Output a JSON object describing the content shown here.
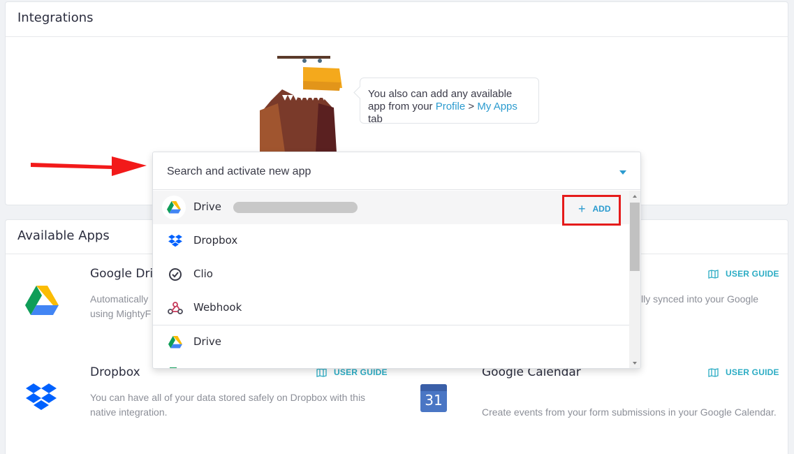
{
  "integrations": {
    "title": "Integrations",
    "bubble": {
      "text_before": "You also can add any available app from your ",
      "profile_link": "Profile",
      "separator": " > ",
      "my_apps_link": "My Apps",
      "text_after": " tab"
    }
  },
  "dropdown": {
    "placeholder": "Search and activate new app",
    "options": [
      {
        "label": "Drive",
        "icon": "google-drive-icon"
      },
      {
        "label": "Dropbox",
        "icon": "dropbox-icon"
      },
      {
        "label": "Clio",
        "icon": "clio-icon"
      },
      {
        "label": "Webhook",
        "icon": "webhook-icon"
      },
      {
        "label": "Drive",
        "icon": "google-drive-icon"
      }
    ],
    "add_label": "ADD"
  },
  "available_apps": {
    "title": "Available Apps",
    "guide_label": "USER GUIDE",
    "apps": [
      {
        "name": "Google Drive",
        "desc_line1": "Automatically",
        "desc_line2": "using MightyF",
        "icon": "google-drive-icon"
      },
      {
        "name": "",
        "desc_line1": "lly synced into your Google",
        "desc_line2": "",
        "icon": ""
      },
      {
        "name": "Dropbox",
        "desc_line1": "You can have all of your data stored safely on Dropbox with this",
        "desc_line2": "native integration.",
        "icon": "dropbox-icon"
      },
      {
        "name": "Google Calendar",
        "desc_line1": "Create events from your form submissions in your Google Calendar.",
        "desc_line2": "",
        "icon": "google-calendar-icon",
        "calendar_day": "31"
      }
    ]
  },
  "colors": {
    "accent": "#2b9bcf",
    "highlight": "#e51b1b",
    "guide": "#2bacc4"
  }
}
